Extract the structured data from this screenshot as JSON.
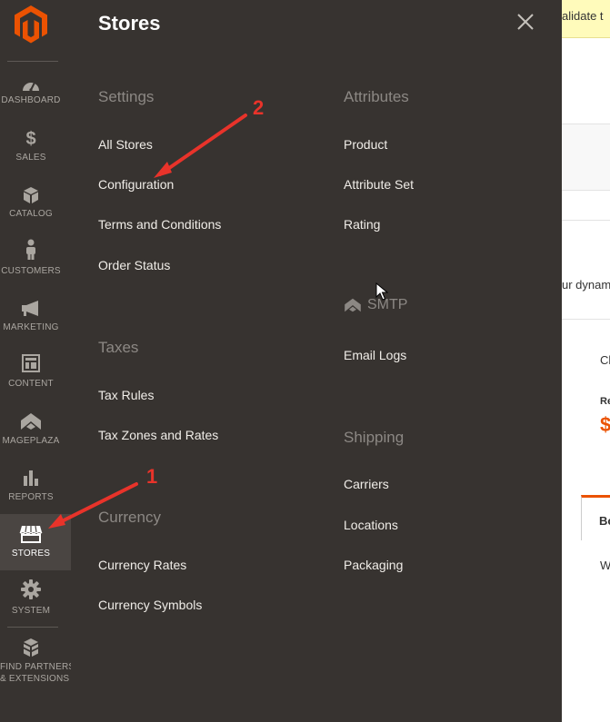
{
  "sidebar": {
    "items": [
      {
        "label": "DASHBOARD",
        "icon": "dashboard-icon"
      },
      {
        "label": "SALES",
        "icon": "dollar-icon"
      },
      {
        "label": "CATALOG",
        "icon": "cube-icon"
      },
      {
        "label": "CUSTOMERS",
        "icon": "person-icon"
      },
      {
        "label": "MARKETING",
        "icon": "megaphone-icon"
      },
      {
        "label": "CONTENT",
        "icon": "layout-icon"
      },
      {
        "label": "MAGEPLAZA",
        "icon": "mageplaza-icon"
      },
      {
        "label": "REPORTS",
        "icon": "bar-chart-icon"
      },
      {
        "label": "STORES",
        "icon": "storefront-icon",
        "active": true
      },
      {
        "label": "SYSTEM",
        "icon": "gear-icon"
      },
      {
        "label_line1": "FIND PARTNERS",
        "label_line2": "& EXTENSIONS",
        "icon": "blocks-icon"
      }
    ]
  },
  "panel": {
    "title": "Stores",
    "close_icon": "close-icon",
    "settings": {
      "heading": "Settings",
      "links": [
        "All Stores",
        "Configuration",
        "Terms and Conditions",
        "Order Status"
      ]
    },
    "taxes": {
      "heading": "Taxes",
      "links": [
        "Tax Rules",
        "Tax Zones and Rates"
      ]
    },
    "currency": {
      "heading": "Currency",
      "links": [
        "Currency Rates",
        "Currency Symbols"
      ]
    },
    "attributes": {
      "heading": "Attributes",
      "links": [
        "Product",
        "Attribute Set",
        "Rating"
      ]
    },
    "smtp": {
      "heading": "SMTP",
      "icon": "mageplaza-icon",
      "links": [
        "Email Logs"
      ]
    },
    "shipping": {
      "heading": "Shipping",
      "links": [
        "Carriers",
        "Locations",
        "Packaging"
      ]
    }
  },
  "background_page": {
    "notice_text": "alidate t",
    "text_dynamic": "ur dynam",
    "text_c": "Cl",
    "text_r": "Re",
    "text_dollar": "$",
    "text_tab": "Bo",
    "text_w": "W"
  },
  "annotations": {
    "step1": "1",
    "step2": "2",
    "arrow_color": "#e8332a"
  },
  "colors": {
    "menu_bg": "#373330",
    "accent": "#eb5202",
    "active_item_bg": "#4a4542"
  }
}
